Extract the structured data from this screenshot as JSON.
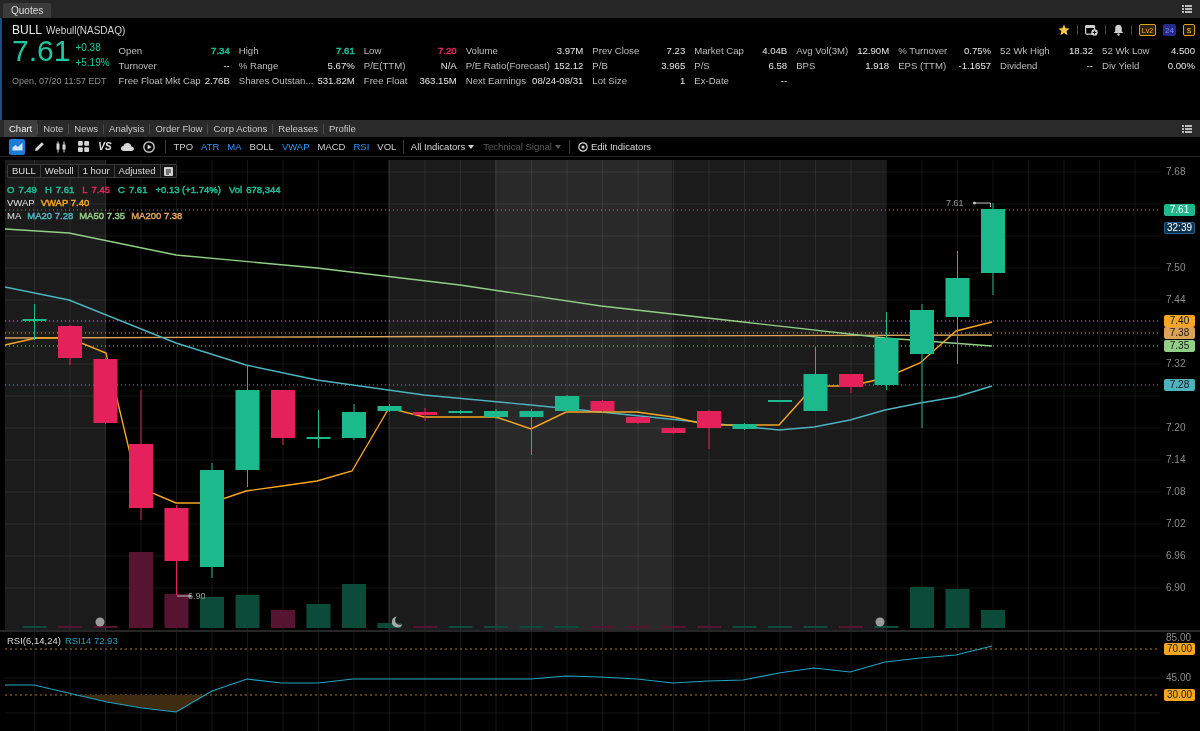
{
  "panel_header": {
    "tab": "Quotes"
  },
  "quote": {
    "symbol": "BULL",
    "exchange": "Webull(NASDAQ)",
    "price": "7.61",
    "change": "+0.38",
    "change_percent": "+5.19%",
    "status": "Open, 07/20 11:57 EDT",
    "badges": [
      "Lv2",
      "24",
      "$"
    ],
    "stats": [
      [
        {
          "text": "Open",
          "kind": "label"
        },
        {
          "text": "7.34",
          "kind": "value",
          "color": "#1fbf95"
        },
        {
          "text": "High",
          "kind": "label"
        },
        {
          "text": "7.61",
          "kind": "value",
          "color": "#1fbf95"
        },
        {
          "text": "Low",
          "kind": "label"
        },
        {
          "text": "7.20",
          "kind": "value",
          "color": "#e8245f"
        },
        {
          "text": "Volume",
          "kind": "label"
        },
        {
          "text": "3.97M",
          "kind": "value"
        },
        {
          "text": "Prev Close",
          "kind": "label"
        },
        {
          "text": "7.23",
          "kind": "value"
        },
        {
          "text": "Market Cap",
          "kind": "label"
        },
        {
          "text": "4.04B",
          "kind": "value"
        },
        {
          "text": "Avg Vol(3M)",
          "kind": "label"
        },
        {
          "text": "12.90M",
          "kind": "value"
        },
        {
          "text": "% Turnover",
          "kind": "label"
        },
        {
          "text": "0.75%",
          "kind": "value"
        },
        {
          "text": "52 Wk High",
          "kind": "label"
        },
        {
          "text": "18.32",
          "kind": "value"
        },
        {
          "text": "52 Wk Low",
          "kind": "label"
        },
        {
          "text": "4.500",
          "kind": "value"
        }
      ],
      [
        {
          "text": "Turnover",
          "kind": "label"
        },
        {
          "text": "--",
          "kind": "value"
        },
        {
          "text": "% Range",
          "kind": "label"
        },
        {
          "text": "5.67%",
          "kind": "value"
        },
        {
          "text": "P/E(TTM)",
          "kind": "label"
        },
        {
          "text": "N/A",
          "kind": "value"
        },
        {
          "text": "P/E Ratio(Forecast)",
          "kind": "label"
        },
        {
          "text": "152.12",
          "kind": "value"
        },
        {
          "text": "P/B",
          "kind": "label"
        },
        {
          "text": "3.965",
          "kind": "value"
        },
        {
          "text": "P/S",
          "kind": "label"
        },
        {
          "text": "6.58",
          "kind": "value"
        },
        {
          "text": "BPS",
          "kind": "label"
        },
        {
          "text": "1.918",
          "kind": "value"
        },
        {
          "text": "EPS (TTM)",
          "kind": "label"
        },
        {
          "text": "-1.1657",
          "kind": "value"
        },
        {
          "text": "Dividend",
          "kind": "label"
        },
        {
          "text": "--",
          "kind": "value"
        },
        {
          "text": "Div Yield",
          "kind": "label"
        },
        {
          "text": "0.00%",
          "kind": "value"
        }
      ],
      [
        {
          "text": "Free Float Mkt Cap",
          "kind": "label"
        },
        {
          "text": "2.76B",
          "kind": "value"
        },
        {
          "text": "Shares Outstan...",
          "kind": "label"
        },
        {
          "text": "531.82M",
          "kind": "value"
        },
        {
          "text": "Free Float",
          "kind": "label"
        },
        {
          "text": "363.15M",
          "kind": "value"
        },
        {
          "text": "Next Earnings",
          "kind": "label"
        },
        {
          "text": "08/24-08/31",
          "kind": "value"
        },
        {
          "text": "Lot Size",
          "kind": "label"
        },
        {
          "text": "1",
          "kind": "value"
        },
        {
          "text": "Ex-Date",
          "kind": "label"
        },
        {
          "text": "--",
          "kind": "value"
        }
      ]
    ]
  },
  "chart_tabs": [
    {
      "label": "Chart",
      "selected": true
    },
    {
      "label": "Note",
      "selected": false
    },
    {
      "label": "News",
      "selected": false
    },
    {
      "label": "Analysis",
      "selected": false
    },
    {
      "label": "Order Flow",
      "selected": false
    },
    {
      "label": "Corp Actions",
      "selected": false
    },
    {
      "label": "Releases",
      "selected": false
    },
    {
      "label": "Profile",
      "selected": false
    }
  ],
  "toolbar": {
    "tools": [
      {
        "kind": "area",
        "selected": true
      },
      {
        "kind": "pencil",
        "selected": false
      },
      {
        "kind": "candles",
        "selected": false
      },
      {
        "kind": "grid",
        "selected": false
      },
      {
        "kind": "text",
        "text": "VS",
        "selected": false
      },
      {
        "kind": "cloud",
        "selected": false
      },
      {
        "kind": "replay",
        "selected": false
      }
    ],
    "indicators": [
      {
        "label": "TPO",
        "on": false
      },
      {
        "label": "ATR",
        "on": true
      },
      {
        "label": "MA",
        "on": true
      },
      {
        "label": "BOLL",
        "on": false
      },
      {
        "label": "VWAP",
        "on": true
      },
      {
        "label": "MACD",
        "on": false
      },
      {
        "label": "RSI",
        "on": true
      },
      {
        "label": "VOL",
        "on": false
      }
    ],
    "menus": [
      {
        "label": "All Indicators",
        "disabled": false
      },
      {
        "label": "Technical Signal",
        "disabled": true
      }
    ],
    "edit": "Edit Indicators"
  },
  "chart": {
    "legend": [
      "BULL",
      "Webull",
      "1 hour",
      "Adjusted"
    ],
    "ohlc": [
      {
        "label": "O",
        "value": "7.49",
        "color": "#1fbf95"
      },
      {
        "label": "H",
        "value": "7.61",
        "color": "#1fbf95"
      },
      {
        "label": "L",
        "value": "7.45",
        "color": "#e8245f"
      },
      {
        "label": "C",
        "value": "7.61",
        "color": "#1fbf95"
      },
      {
        "value": "+0.13 (+1.74%)",
        "color": "#1fbf95"
      },
      {
        "label": "Vol",
        "value": "678,344",
        "color": "#1fbf95"
      }
    ],
    "studies": [
      {
        "name": "VWAP",
        "values": [
          {
            "text": "VWAP 7.40",
            "color": "#f5a623"
          }
        ]
      },
      {
        "name": "MA",
        "values": [
          {
            "text": "MA20 7.28",
            "color": "#4db3bf"
          },
          {
            "text": "MA50 7.35",
            "color": "#92cf86"
          },
          {
            "text": "MA200 7.38",
            "color": "#dba25a"
          }
        ]
      }
    ],
    "markers": [
      "7.61",
      "6.90"
    ],
    "axis_ticks": [
      "7.68",
      "7.50",
      "7.44",
      "7.32",
      "7.20",
      "7.14",
      "7.08",
      "7.02",
      "6.96",
      "6.90"
    ],
    "price_tags": [
      {
        "text": "7.61",
        "color": "#1db98b",
        "kind": "last"
      },
      {
        "text": "32:39",
        "color": "#0e3150",
        "kind": "timer"
      },
      {
        "text": "7.40",
        "color": "#f5a623",
        "kind": "study"
      },
      {
        "text": "7.38",
        "color": "#dba25a",
        "kind": "study"
      },
      {
        "text": "7.35",
        "color": "#92cf86",
        "kind": "study"
      },
      {
        "text": "7.28",
        "color": "#4db3bf",
        "kind": "study"
      }
    ]
  },
  "rsi": {
    "title": "RSI(6,14,24)",
    "value": "RSI14 72.93",
    "axis_ticks": [
      "85.00",
      "45.00"
    ],
    "tags": [
      "70.00",
      "30.00"
    ]
  }
}
